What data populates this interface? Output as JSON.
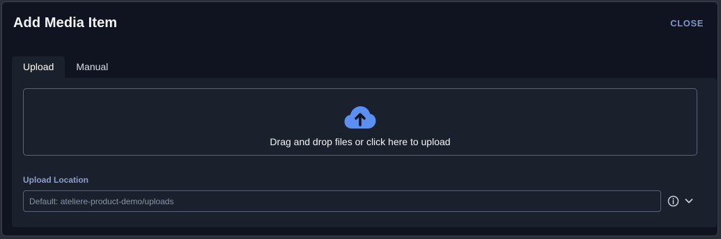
{
  "dialog": {
    "title": "Add Media Item",
    "close_label": "CLOSE"
  },
  "tabs": [
    {
      "label": "Upload",
      "active": true
    },
    {
      "label": "Manual",
      "active": false
    }
  ],
  "upload": {
    "dropzone_text": "Drag and drop files or click here to upload",
    "icon": "cloud-upload-icon",
    "icon_color": "#5b8ff0"
  },
  "location": {
    "label": "Upload Location",
    "placeholder": "Default: ateliere-product-demo/uploads",
    "value": ""
  },
  "colors": {
    "accent": "#5b8ff0",
    "close": "#7f95c8"
  }
}
